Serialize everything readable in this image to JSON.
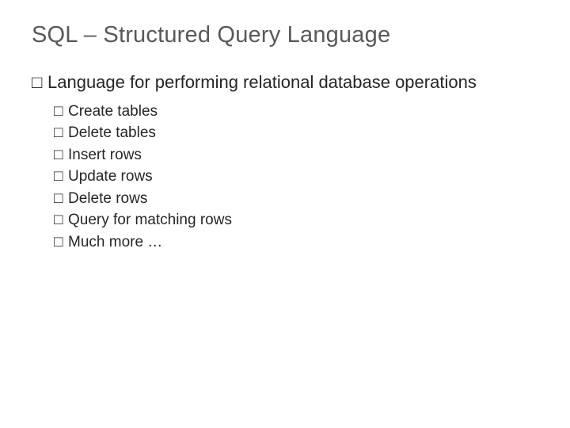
{
  "title": "SQL – Structured Query Language",
  "main_point": "Language for performing relational database operations",
  "sub_points": [
    "Create tables",
    "Delete tables",
    "Insert rows",
    "Update rows",
    "Delete rows",
    "Query for matching rows",
    "Much more …"
  ]
}
